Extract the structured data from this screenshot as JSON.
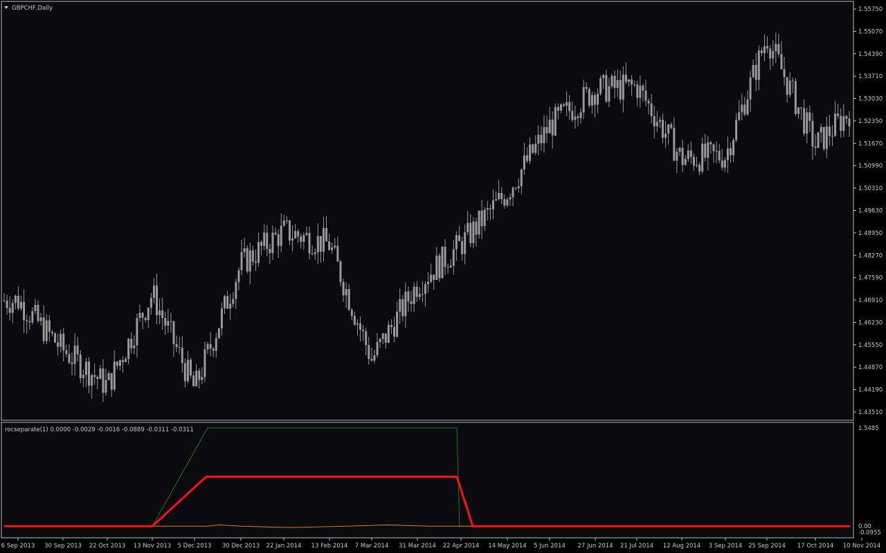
{
  "colors": {
    "background": "#000000",
    "chart_background": "#0a0a0f",
    "border": "#c0c0c0",
    "candle": "#9a9a9a",
    "text": "#c8c8c8",
    "roc_green": "#1a7a1a",
    "roc_blue": "#1f3fd6",
    "roc_orange": "#e07a1a",
    "roc_red": "#ff1010"
  },
  "main_chart": {
    "title": "GBPCHF,Daily",
    "menu_icon": "triangle-down-icon"
  },
  "indicator": {
    "label": "rocseparate(1) 0.0000 -0.0029 -0.0016 -0.0889 -0.0311 -0.0311"
  },
  "chart_data": [
    {
      "type": "candlestick",
      "title": "GBPCHF,Daily",
      "y_ticks": [
        "1.55750",
        "1.55070",
        "1.54390",
        "1.53710",
        "1.53030",
        "1.52350",
        "1.51670",
        "1.50990",
        "1.50310",
        "1.49630",
        "1.48950",
        "1.48270",
        "1.47590",
        "1.46910",
        "1.46230",
        "1.45550",
        "1.44870",
        "1.44190",
        "1.43510"
      ],
      "ylim": [
        1.4351,
        1.5575
      ],
      "x_ticks": [
        "6 Sep 2013",
        "30 Sep 2013",
        "22 Oct 2013",
        "13 Nov 2013",
        "5 Dec 2013",
        "30 Dec 2013",
        "22 Jan 2014",
        "13 Feb 2014",
        "7 Mar 2014",
        "31 Mar 2014",
        "22 Apr 2014",
        "14 May 2014",
        "5 Jun 2014",
        "27 Jun 2014",
        "21 Jul 2014",
        "12 Aug 2014",
        "3 Sep 2014",
        "25 Sep 2014",
        "17 Oct 2014",
        "10 Nov 2014"
      ],
      "close_path": [
        [
          "6 Sep 2013",
          1.469
        ],
        [
          "30 Sep 2013",
          1.454
        ],
        [
          "22 Oct 2013",
          1.443
        ],
        [
          "13 Nov 2013",
          1.471
        ],
        [
          "5 Dec 2013",
          1.442
        ],
        [
          "30 Dec 2013",
          1.48
        ],
        [
          "22 Jan 2014",
          1.49
        ],
        [
          "13 Feb 2014",
          1.486
        ],
        [
          "7 Mar 2014",
          1.451
        ],
        [
          "31 Mar 2014",
          1.474
        ],
        [
          "22 Apr 2014",
          1.486
        ],
        [
          "14 May 2014",
          1.502
        ],
        [
          "5 Jun 2014",
          1.522
        ],
        [
          "27 Jun 2014",
          1.533
        ],
        [
          "21 Jul 2014",
          1.534
        ],
        [
          "12 Aug 2014",
          1.512
        ],
        [
          "3 Sep 2014",
          1.513
        ],
        [
          "25 Sep 2014",
          1.549
        ],
        [
          "17 Oct 2014",
          1.516
        ],
        [
          "10 Nov 2014",
          1.53
        ]
      ]
    },
    {
      "type": "line",
      "title": "rocseparate(1) 0.0000 -0.0029 -0.0016 -0.0889 -0.0311 -0.0311",
      "y_ticks": [
        "1.5485",
        "0.00",
        "-0.0955"
      ],
      "series": [
        {
          "color": "#1a7a1a",
          "values": [
            0,
            0,
            0,
            1.5485,
            1.5485,
            1.5485,
            1.5485,
            1.5485,
            1.5485,
            1.5485,
            1.5485,
            0,
            0,
            0,
            0,
            0,
            0,
            0,
            0,
            0
          ]
        },
        {
          "color": "#1f3fd6",
          "values": [
            0,
            0,
            0,
            0.78,
            0.78,
            0.78,
            0.78,
            0.78,
            0.78,
            0.78,
            0.78,
            0,
            0,
            0,
            0,
            0,
            0,
            0,
            0,
            0
          ]
        },
        {
          "color": "#e07a1a",
          "values": [
            0,
            0,
            0,
            0,
            0.02,
            0,
            -0.02,
            0,
            0.02,
            0,
            0,
            0,
            0,
            0,
            0,
            0,
            0,
            0,
            0,
            0
          ]
        },
        {
          "color": "#ff1010",
          "values": [
            0,
            0,
            0,
            0.78,
            0.78,
            0.78,
            0.78,
            0.78,
            0.78,
            0.78,
            0.78,
            0,
            0,
            0,
            0,
            0,
            0,
            0,
            0,
            0
          ]
        }
      ]
    }
  ]
}
